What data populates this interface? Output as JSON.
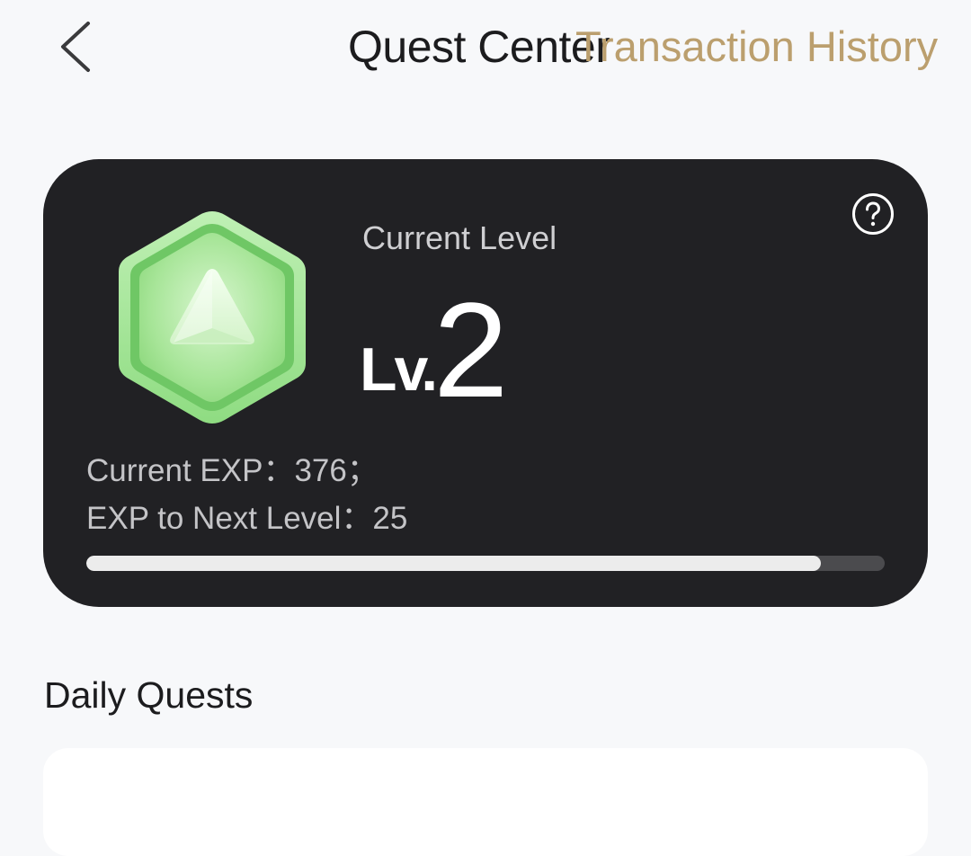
{
  "header": {
    "title": "Quest Center",
    "history_link": "Transaction History",
    "back_icon": "chevron-left-icon"
  },
  "level_card": {
    "caption": "Current Level",
    "level_prefix": "Lv.",
    "level_number": "2",
    "current_exp_text": "Current EXP：376；",
    "next_level_text": "EXP to Next Level：25",
    "progress_fraction": 0.92,
    "help_icon": "question-circle-icon",
    "badge_icon": "hexagon-level-badge-icon"
  },
  "daily_quests": {
    "title": "Daily Quests"
  },
  "colors": {
    "page_background": "#f7f8fa",
    "card_background": "#212124",
    "accent_gold": "#bb9f6e",
    "badge_green": "#77c96a",
    "progress_fill": "#ececec",
    "progress_track": "#4b4b4e"
  }
}
